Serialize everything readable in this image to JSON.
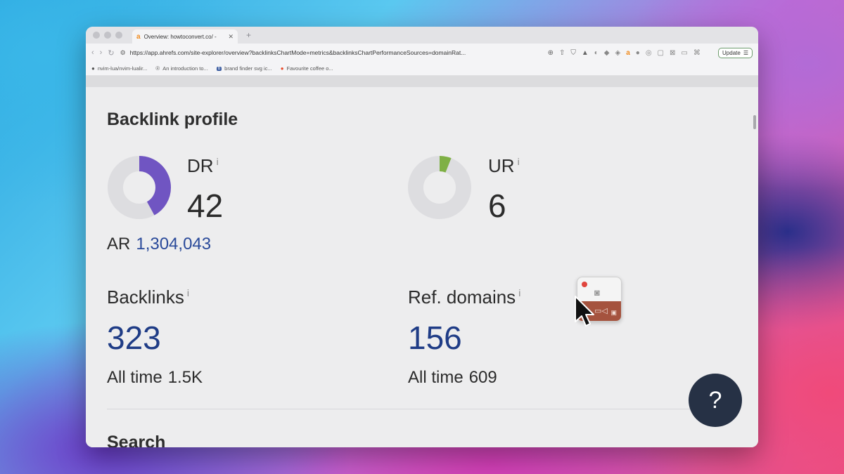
{
  "browser": {
    "tab_title": "Overview: howtoconvert.co/ -",
    "tab_favicon": "a",
    "new_tab": "+",
    "url": "https://app.ahrefs.com/site-explorer/overview?backlinksChartMode=metrics&backlinksChartPerformanceSources=domainRat...",
    "update_label": "Update",
    "bookmarks": [
      {
        "label": "nvim-lua/nvim-lualir...",
        "icon": "github-icon"
      },
      {
        "label": "An introduction to...",
        "icon": "r-icon"
      },
      {
        "label": "brand finder svg ic...",
        "icon": "b-icon"
      },
      {
        "label": "Favourite coffee o...",
        "icon": "coffee-icon"
      }
    ]
  },
  "page": {
    "heading": "Backlink profile",
    "dr": {
      "label": "DR",
      "info": "i",
      "value": "42",
      "numeric": 42
    },
    "ar": {
      "label": "AR",
      "value": "1,304,043"
    },
    "ur": {
      "label": "UR",
      "info": "i",
      "value": "6",
      "numeric": 6
    },
    "backlinks": {
      "label": "Backlinks",
      "info": "i",
      "value": "323",
      "all_time_label": "All time",
      "all_time_value": "1.5K"
    },
    "ref_domains": {
      "label": "Ref. domains",
      "info": "i",
      "value": "156",
      "all_time_label": "All time",
      "all_time_value": "609"
    },
    "search_heading": "Search",
    "help": "?"
  },
  "colors": {
    "dr_ring": "#7055c2",
    "ur_ring": "#7fb045",
    "ring_track": "#dddde0",
    "blue_value": "#1f3c86"
  }
}
